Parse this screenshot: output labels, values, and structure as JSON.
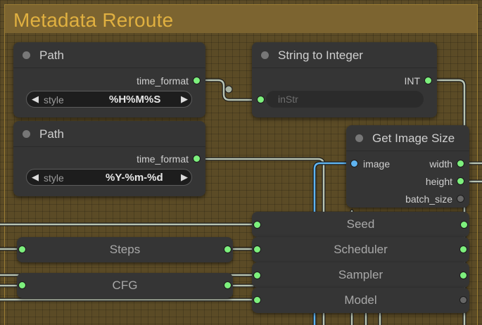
{
  "group": {
    "title": "Metadata Reroute"
  },
  "path_node_1": {
    "title": "Path",
    "output_label": "time_format",
    "widget_name": "style",
    "widget_value": "%H%M%S"
  },
  "path_node_2": {
    "title": "Path",
    "output_label": "time_format",
    "widget_name": "style",
    "widget_value": "%Y-%m-%d"
  },
  "string_to_int": {
    "title": "String to Integer",
    "output_label": "INT",
    "input_placeholder": "inStr"
  },
  "get_image_size": {
    "title": "Get Image Size",
    "input_label": "image",
    "outputs": [
      "width",
      "height",
      "batch_size"
    ]
  },
  "reroutes": {
    "seed": "Seed",
    "scheduler": "Scheduler",
    "sampler": "Sampler",
    "model": "Model",
    "steps": "Steps",
    "cfg": "CFG"
  },
  "icons": {
    "left_arrow": "◀",
    "right_arrow": "▶"
  },
  "colors": {
    "wire": "#b9c4b2",
    "blue_wire": "#5fb4f0",
    "slot_green": "#7df07d",
    "group_title": "#e0b040"
  }
}
